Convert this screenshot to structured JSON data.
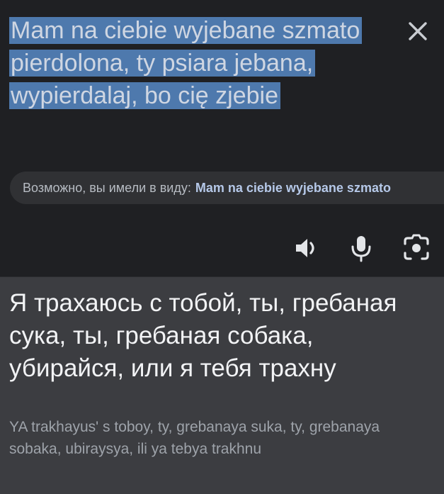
{
  "source": {
    "text": "Mam na ciebie wyjebane szmato pierdolona, ty psiara jebana, wypierdalaj, bo cię zjebie",
    "selected": true
  },
  "suggestion": {
    "prefix": "Возможно, вы имели в виду:",
    "corrected_text": "Mam na ciebie wyjebane szmato"
  },
  "translation": {
    "text": "Я трахаюсь с тобой, ты, гребаная сука, ты, гребаная собака, убирайся, или я тебя трахну",
    "transliteration": "YA trakhayus' s toboy, ty, grebanaya suka, ty, grebanaya sobaka, ubiraysya, ili ya tebya trakhnu"
  },
  "icons": {
    "close": "close-icon",
    "speaker": "speaker-icon",
    "microphone": "microphone-icon",
    "camera": "camera-icon"
  },
  "colors": {
    "source_background": "#1f2023",
    "selection_highlight": "#4e79ad",
    "result_background": "#3c3d41",
    "chip_background": "#303134"
  }
}
